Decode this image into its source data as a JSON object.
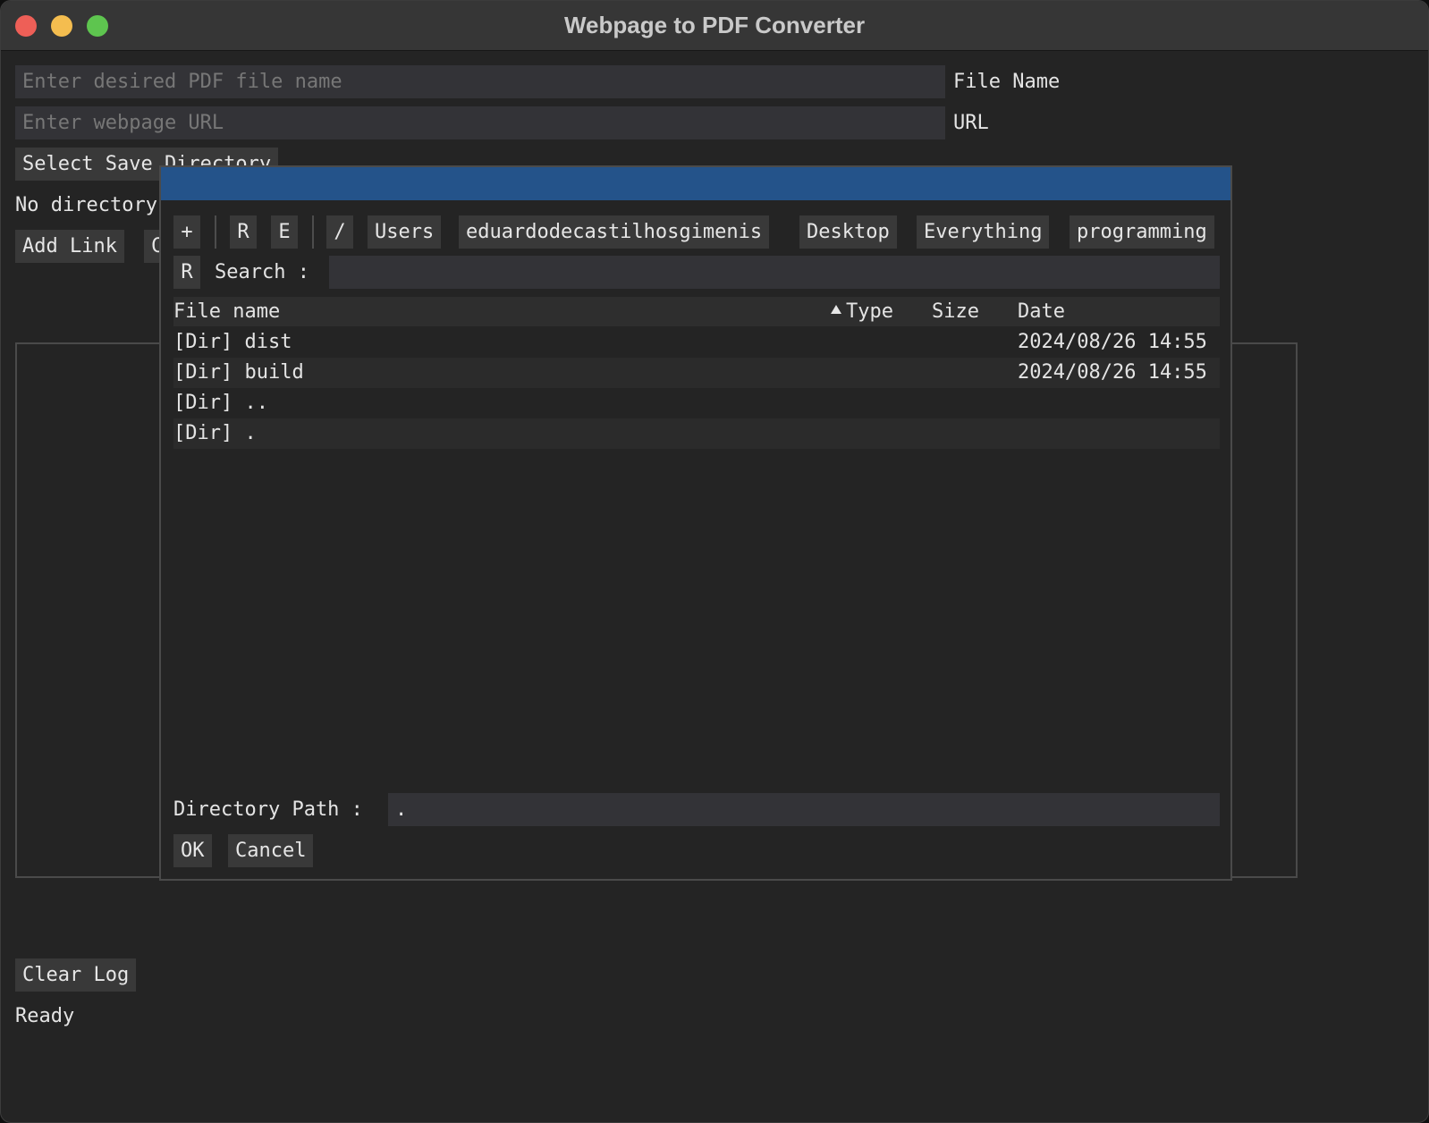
{
  "window": {
    "title": "Webpage to PDF Converter"
  },
  "form": {
    "file_name_placeholder": "Enter desired PDF file name",
    "file_name_label": "File Name",
    "url_placeholder": "Enter webpage URL",
    "url_label": "URL",
    "select_dir_button": "Select Save Directory",
    "no_directory_text": "No directory",
    "add_link_button": "Add Link",
    "hidden_button_partial": "C"
  },
  "log": {
    "clear_button": "Clear Log",
    "status": "Ready"
  },
  "dialog": {
    "toolbar": {
      "add": "+",
      "reset": "R",
      "edit": "E",
      "root": "/",
      "path_segments": [
        "Users",
        "eduardodecastilhosgimenis",
        "Desktop",
        "Everything",
        "programming"
      ]
    },
    "search": {
      "reset": "R",
      "label": "Search :",
      "value": ""
    },
    "columns": {
      "name": "File name",
      "type": "Type",
      "size": "Size",
      "date": "Date"
    },
    "rows": [
      {
        "name": "[Dir] dist",
        "type": "",
        "size": "",
        "date": "2024/08/26 14:55"
      },
      {
        "name": "[Dir] build",
        "type": "",
        "size": "",
        "date": "2024/08/26 14:55"
      },
      {
        "name": "[Dir] ..",
        "type": "",
        "size": "",
        "date": ""
      },
      {
        "name": "[Dir] .",
        "type": "",
        "size": "",
        "date": ""
      }
    ],
    "directory_path": {
      "label": "Directory Path :",
      "value": "."
    },
    "ok_button": "OK",
    "cancel_button": "Cancel"
  },
  "colors": {
    "dialog_header": "#24538a",
    "window_bg": "#242424",
    "input_bg": "#333337",
    "button_bg": "#393939"
  }
}
